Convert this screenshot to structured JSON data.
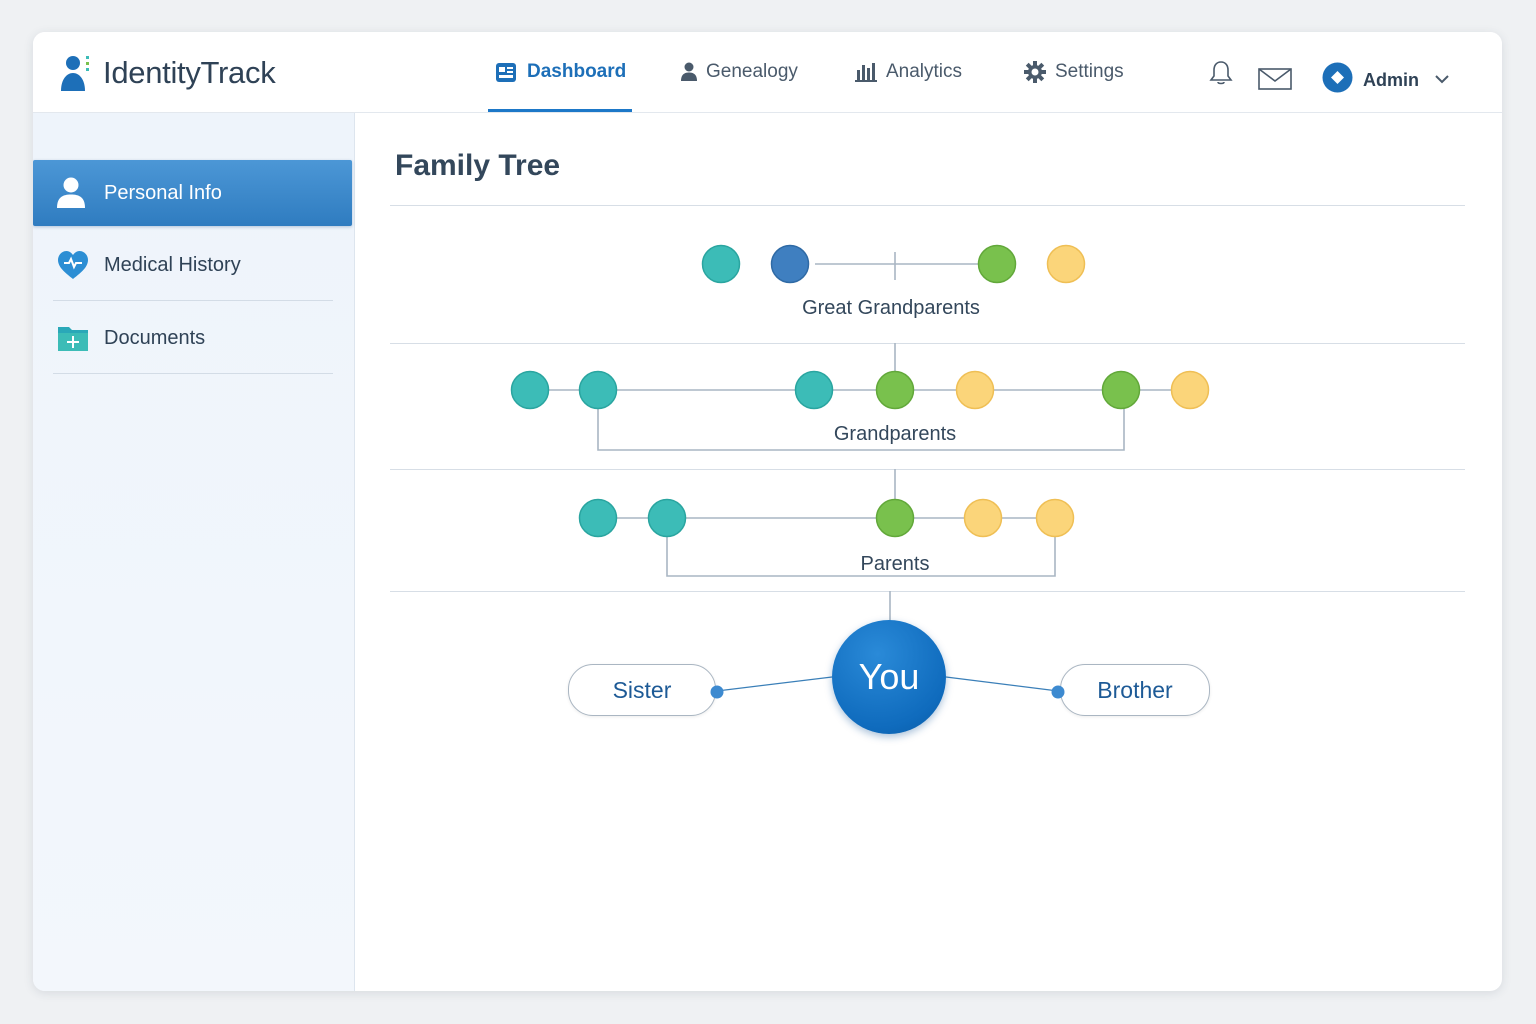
{
  "app": {
    "name": "IdentityTrack"
  },
  "nav": {
    "items": [
      {
        "label": "Dashboard",
        "icon": "dashboard-icon",
        "active": true
      },
      {
        "label": "Genealogy",
        "icon": "person-icon",
        "active": false
      },
      {
        "label": "Analytics",
        "icon": "bar-chart-icon",
        "active": false
      },
      {
        "label": "Settings",
        "icon": "gear-icon",
        "active": false
      }
    ]
  },
  "header": {
    "notifications_icon": "bell-icon",
    "messages_icon": "mail-icon",
    "user": {
      "label": "Admin",
      "icon": "user-badge-icon",
      "menu_icon": "chevron-down-icon"
    }
  },
  "sidebar": {
    "items": [
      {
        "label": "Personal Info",
        "icon": "person-icon",
        "active": true
      },
      {
        "label": "Medical History",
        "icon": "heart-pulse-icon",
        "active": false
      },
      {
        "label": "Documents",
        "icon": "folder-plus-icon",
        "active": false
      }
    ]
  },
  "main": {
    "title": "Family Tree",
    "generations": [
      {
        "label": "Great Grandparents"
      },
      {
        "label": "Grandparents"
      },
      {
        "label": "Parents"
      }
    ],
    "self": {
      "label": "You"
    },
    "siblings": [
      {
        "label": "Sister"
      },
      {
        "label": "Brother"
      }
    ]
  },
  "colors": {
    "accent": "#1d78c8",
    "teal": "#3cbcb7",
    "blue": "#3f7fc0",
    "green": "#79c14d",
    "yellow": "#fbd57a"
  }
}
